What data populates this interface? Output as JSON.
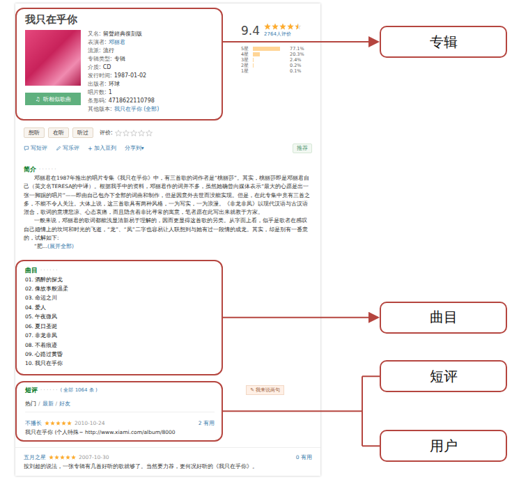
{
  "album": {
    "title": "我只在乎你",
    "info": [
      {
        "label": "又名:",
        "value": "留聲經典復刻版",
        "link": false
      },
      {
        "label": "表演者:",
        "value": "邓丽君",
        "link": true
      },
      {
        "label": "流派:",
        "value": "流行",
        "link": false
      },
      {
        "label": "专辑类型:",
        "value": "专辑",
        "link": false
      },
      {
        "label": "介质:",
        "value": "CD",
        "link": false
      },
      {
        "label": "发行时间:",
        "value": "1987-01-02",
        "link": false
      },
      {
        "label": "出版者:",
        "value": "环球",
        "link": false
      },
      {
        "label": "唱片数:",
        "value": "1",
        "link": false
      },
      {
        "label": "条形码:",
        "value": "4718622110798",
        "link": false
      },
      {
        "label": "其他版本:",
        "value": "我只在乎你 (全部)",
        "link": true
      }
    ],
    "listen_button": {
      "icon": "♫",
      "label": "听相似歌曲"
    }
  },
  "rating": {
    "score": "9.4",
    "stars": 4.5,
    "count": "2764人评价",
    "bars": [
      {
        "label": "5星",
        "level": 0.771,
        "reading": "77.1%"
      },
      {
        "label": "4星",
        "level": 0.203,
        "reading": "20.3%"
      },
      {
        "label": "3星",
        "level": 0.024,
        "reading": "2.4%"
      },
      {
        "label": "2星",
        "level": 0.002,
        "reading": "0.2%"
      },
      {
        "label": "1星",
        "level": 0.001,
        "reading": "0.1%"
      }
    ]
  },
  "status_buttons": [
    "想听",
    "在听",
    "听过"
  ],
  "my_rating": {
    "label": "评价:",
    "stars": 0
  },
  "actions": [
    {
      "icon": "",
      "label": "写短评"
    },
    {
      "icon": "",
      "label": "写乐评"
    },
    {
      "icon": "+",
      "label": "加入豆列"
    },
    {
      "icon": "",
      "label": "分享到▾"
    }
  ],
  "recommend": "推荐",
  "intro": {
    "heading": "简介",
    "dots": "· · · · · ·",
    "paragraphs": [
      "邓丽君在1987年推出的唱片专集《我只在乎你》中，有三首歌的词作者是“桃丽莎”。其实，桃丽莎即是邓丽君自己（英文名TERESA的中译）。根据我手中的资料，邓丽君作的词并不多，虽然她确曾向媒体表示“最大的心愿是出一张一脚踢的唱片”——即由自己包办下全部的词曲和制作，但是因意外去世而没能实现。但是，在此专集中竟有三首之多，不能不令人关注。大体上说，这三首歌具有两种风格，一为写实，一为浪漫。《非龙非凤》以现代汉语与古汉语混合，歌词的意境悲凉、心态哀痛，而且隐含着非比寻常的寓意，笔者愿在此写出来就教于方家。",
      "一般来说，邓丽君的歌词都能浅显清新易于理解的，因而更显得这首歌的另类。从字面上看，似乎是歌者在感叹自己婚情上的坎坷和时光的飞逝，“龙”、“凤”二字也容易让人联想到与她有过一段情的成龙。其实，却是别有一番意的，试解如下:"
    ],
    "more_prefix": "“肥...",
    "more": "(展开全部)"
  },
  "tracks": {
    "heading": "曲目",
    "dots": "· · · · · ·",
    "items": [
      "01. 酒醉的探戈",
      "02. 像故事般温柔",
      "03. 命运之川",
      "04. 爱人",
      "05. 午夜微风",
      "06. 夏日圣诞",
      "07. 非龙非凤",
      "08. 不着痕迹",
      "09. 心路过黄昏",
      "10. 我只在乎你"
    ]
  },
  "reviews": {
    "heading": "短评",
    "dots": "· · · · · ·",
    "total": "( 全部 1064 条 )",
    "write_button": {
      "icon": "✎",
      "label": "我来说两句"
    },
    "filters": [
      {
        "label": "热门",
        "selected": true
      },
      {
        "label": "最新",
        "selected": false
      },
      {
        "label": "好友",
        "selected": false
      }
    ],
    "separator": "/",
    "items": [
      {
        "user": "不播长",
        "stars": 5,
        "date": "2010-10-24",
        "useful": "2 有用",
        "text": "我只在乎你 (个人特殊~ http://www.xiami.com/album/8000"
      },
      {
        "user": "五月之星",
        "stars": 5,
        "date": "2007-10-30",
        "useful": "0 有用",
        "text": "按刘超的说法，一张专辑有几首好听的歌就够了。当然要力荐，更何况好听的《我只在乎你》。"
      }
    ]
  },
  "callouts": {
    "album": "专辑",
    "tracks": "曲目",
    "reviews": "短评",
    "user": "用户"
  }
}
